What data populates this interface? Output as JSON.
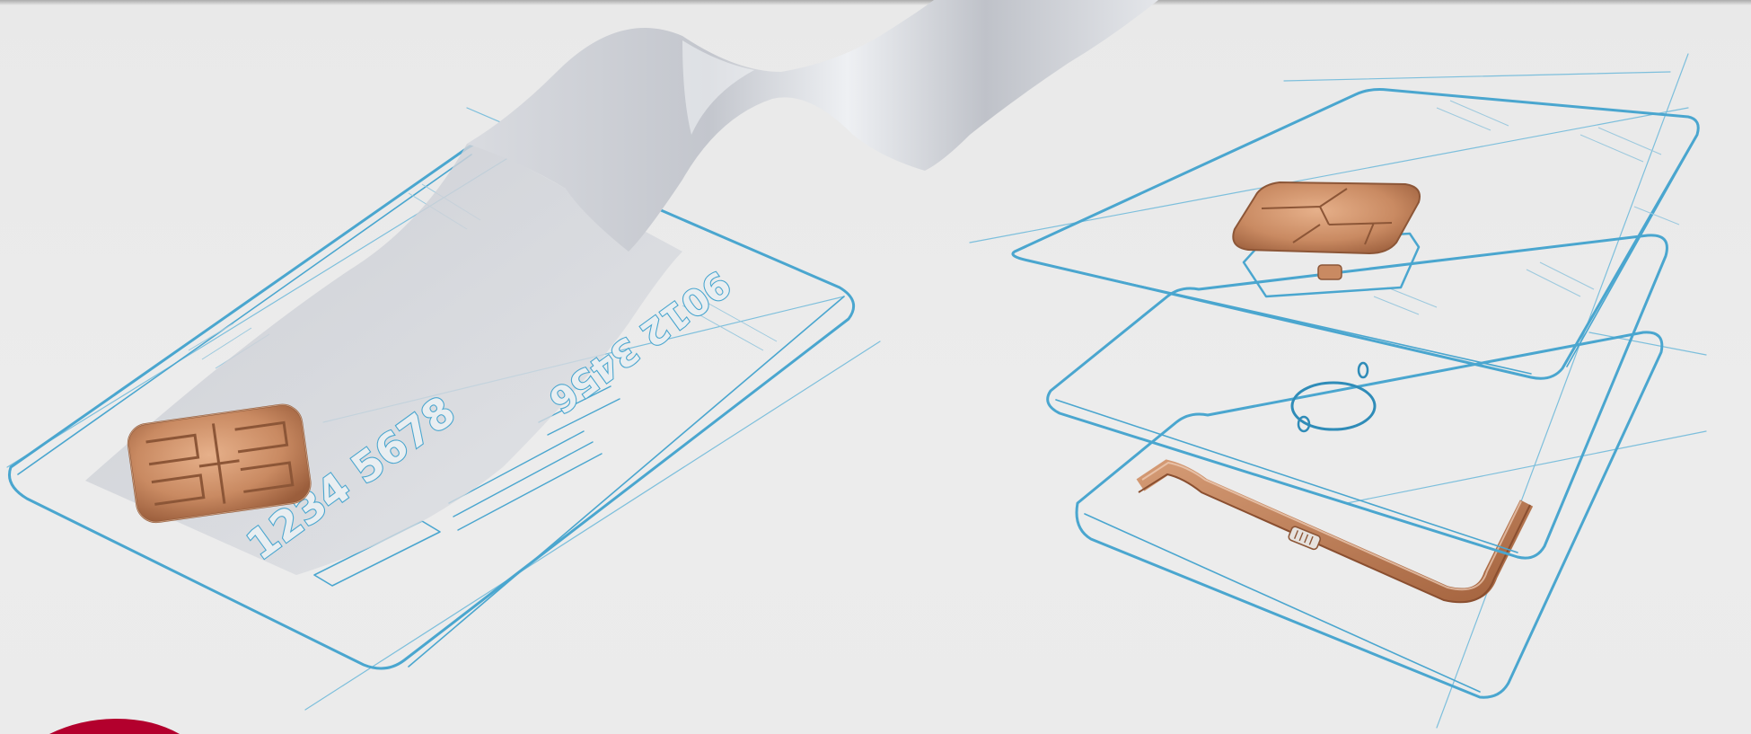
{
  "scene": {
    "card_number_front": "1234 5678",
    "card_number_back": "9012 3456",
    "colors": {
      "background": "#eaeaea",
      "sketch_line": "#4aa6cf",
      "chip_copper": "#c98a62",
      "antenna_copper": "#b06f4a",
      "laminate_film": "#c9ccd3",
      "brand_badge": "#b3002d"
    },
    "icons": [
      "emv-chip-icon",
      "contact-chip-icon",
      "coil-antenna-icon",
      "module-pad-icon"
    ]
  }
}
